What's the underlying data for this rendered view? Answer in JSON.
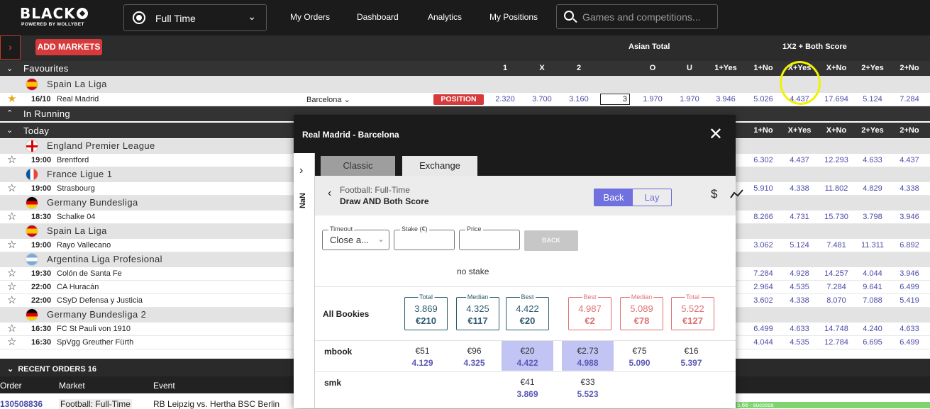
{
  "brand": {
    "name": "BLACK",
    "tagline": "POWERED BY MOLLYBET"
  },
  "header": {
    "sport_select": "Full Time",
    "nav": [
      "My Orders",
      "Dashboard",
      "Analytics",
      "My Positions"
    ],
    "search_placeholder": "Games and competitions..."
  },
  "toolbar": {
    "add_markets": "ADD MARKETS",
    "group_asian": "Asian Total",
    "group_1x2": "1X2 + Both Score"
  },
  "columns": [
    "1",
    "X",
    "2",
    "O",
    "U",
    "1+Yes",
    "1+No",
    "X+Yes",
    "X+No",
    "2+Yes",
    "2+No"
  ],
  "columns_today": [
    "1+No",
    "X+Yes",
    "X+No",
    "2+Yes",
    "2+No"
  ],
  "sections": {
    "favourites": "Favourites",
    "in_running": "In Running",
    "today": "Today"
  },
  "favourites": {
    "league": "Spain La Liga",
    "match": {
      "date": "16/10",
      "home": "Real Madrid",
      "away": "Barcelona",
      "position_badge": "POSITION",
      "stake": "3",
      "odds": [
        "2.320",
        "3.700",
        "3.160",
        "1.970",
        "1.970",
        "3.946",
        "5.026",
        "4.437",
        "17.694",
        "5.124",
        "7.284"
      ]
    }
  },
  "today": [
    {
      "league": "England Premier League",
      "flag": "england",
      "matches": [
        {
          "time": "19:00",
          "team": "Brentford",
          "odds": [
            "6.302",
            "4.437",
            "12.293",
            "4.633",
            "4.437"
          ]
        }
      ]
    },
    {
      "league": "France Ligue 1",
      "flag": "france",
      "matches": [
        {
          "time": "19:00",
          "team": "Strasbourg",
          "odds": [
            "5.910",
            "4.338",
            "11.802",
            "4.829",
            "4.338"
          ]
        }
      ]
    },
    {
      "league": "Germany Bundesliga",
      "flag": "germany",
      "matches": [
        {
          "time": "18:30",
          "team": "Schalke 04",
          "odds": [
            "8.266",
            "4.731",
            "15.730",
            "3.798",
            "3.946"
          ]
        }
      ]
    },
    {
      "league": "Spain La Liga",
      "flag": "spain",
      "matches": [
        {
          "time": "19:00",
          "team": "Rayo Vallecano",
          "odds": [
            "3.062",
            "5.124",
            "7.481",
            "11.311",
            "6.892"
          ]
        }
      ]
    },
    {
      "league": "Argentina Liga Profesional",
      "flag": "argentina",
      "matches": [
        {
          "time": "19:30",
          "team": "Colón de Santa Fe",
          "odds": [
            "7.284",
            "4.928",
            "14.257",
            "4.044",
            "3.946"
          ]
        },
        {
          "time": "22:00",
          "team": "CA Huracán",
          "odds": [
            "2.964",
            "4.535",
            "7.284",
            "9.641",
            "6.499"
          ]
        },
        {
          "time": "22:00",
          "team": "CSyD Defensa y Justicia",
          "odds": [
            "3.602",
            "4.338",
            "8.070",
            "7.088",
            "5.419"
          ]
        }
      ]
    },
    {
      "league": "Germany Bundesliga 2",
      "flag": "germany",
      "matches": [
        {
          "time": "16:30",
          "team": "FC St Pauli von 1910",
          "odds": [
            "6.499",
            "4.633",
            "14.748",
            "4.240",
            "4.633"
          ]
        },
        {
          "time": "16:30",
          "team": "SpVgg Greuther Fürth",
          "odds": [
            "4.044",
            "4.535",
            "12.784",
            "6.695",
            "6.499"
          ]
        }
      ]
    }
  ],
  "recent_orders": {
    "title": "RECENT ORDERS 16",
    "cols": [
      "Order",
      "Market",
      "Event"
    ],
    "row": {
      "order": "130508836",
      "market": "Football: Full-Time",
      "event": "RB Leipzig vs. Hertha BSC Berlin",
      "status": "5.66 - success"
    }
  },
  "modal": {
    "title": "Real Madrid  -  Barcelona",
    "side_label": "NaN",
    "tabs": [
      "Classic",
      "Exchange"
    ],
    "market_line1": "Football: Full-Time",
    "market_line2": "Draw AND Both Score",
    "toggle": [
      "Back",
      "Lay"
    ],
    "timeout_label": "Timeout",
    "timeout_value": "Close a...",
    "stake_label": "Stake (€)",
    "price_label": "Price",
    "back_button": "BACK",
    "no_stake": "no stake",
    "all_bookies": "All Bookies",
    "summary": [
      {
        "label": "Total",
        "odds": "3.869",
        "amount": "€210",
        "side": "back"
      },
      {
        "label": "Median",
        "odds": "4.325",
        "amount": "€117",
        "side": "back"
      },
      {
        "label": "Best",
        "odds": "4.422",
        "amount": "€20",
        "side": "back"
      },
      {
        "label": "Best",
        "odds": "4.987",
        "amount": "€2",
        "side": "lay"
      },
      {
        "label": "Median",
        "odds": "5.089",
        "amount": "€78",
        "side": "lay"
      },
      {
        "label": "Total",
        "odds": "5.522",
        "amount": "€127",
        "side": "lay"
      }
    ],
    "bookies": [
      {
        "name": "mbook",
        "cells": [
          {
            "amount": "€51",
            "odds": "4.129"
          },
          {
            "amount": "€96",
            "odds": "4.325"
          },
          {
            "amount": "€20",
            "odds": "4.422",
            "highlight": true
          },
          {
            "amount": "€2.73",
            "odds": "4.988",
            "highlight": true
          },
          {
            "amount": "€75",
            "odds": "5.090"
          },
          {
            "amount": "€16",
            "odds": "5.397"
          }
        ]
      },
      {
        "name": "smk",
        "cells": [
          null,
          null,
          {
            "amount": "€41",
            "odds": "3.869"
          },
          {
            "amount": "€33",
            "odds": "5.523"
          },
          null,
          null
        ]
      }
    ]
  }
}
